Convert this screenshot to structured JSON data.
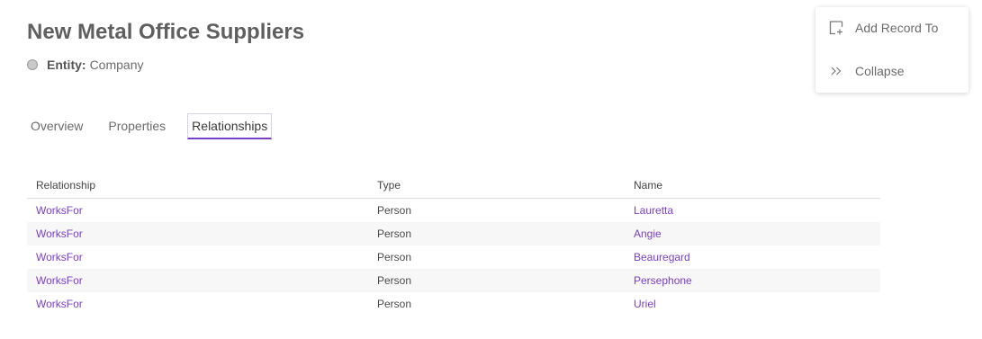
{
  "header": {
    "title": "New Metal Office Suppliers",
    "entity_label": "Entity:",
    "entity_value": "Company"
  },
  "tabs": [
    {
      "label": "Overview",
      "active": false
    },
    {
      "label": "Properties",
      "active": false
    },
    {
      "label": "Relationships",
      "active": true
    }
  ],
  "table": {
    "columns": [
      "Relationship",
      "Type",
      "Name"
    ],
    "rows": [
      {
        "relationship": "WorksFor",
        "type": "Person",
        "name": "Lauretta"
      },
      {
        "relationship": "WorksFor",
        "type": "Person",
        "name": "Angie"
      },
      {
        "relationship": "WorksFor",
        "type": "Person",
        "name": "Beauregard"
      },
      {
        "relationship": "WorksFor",
        "type": "Person",
        "name": "Persephone"
      },
      {
        "relationship": "WorksFor",
        "type": "Person",
        "name": "Uriel"
      }
    ]
  },
  "menu": {
    "add_record_label": "Add Record To",
    "add_record_icon": "add-record-icon",
    "collapse_label": "Collapse",
    "collapse_icon": "double-chevron-right-icon"
  },
  "colors": {
    "accent": "#7a3fc8",
    "title": "#5f5f5f",
    "row_alt": "#f7f7f7"
  }
}
